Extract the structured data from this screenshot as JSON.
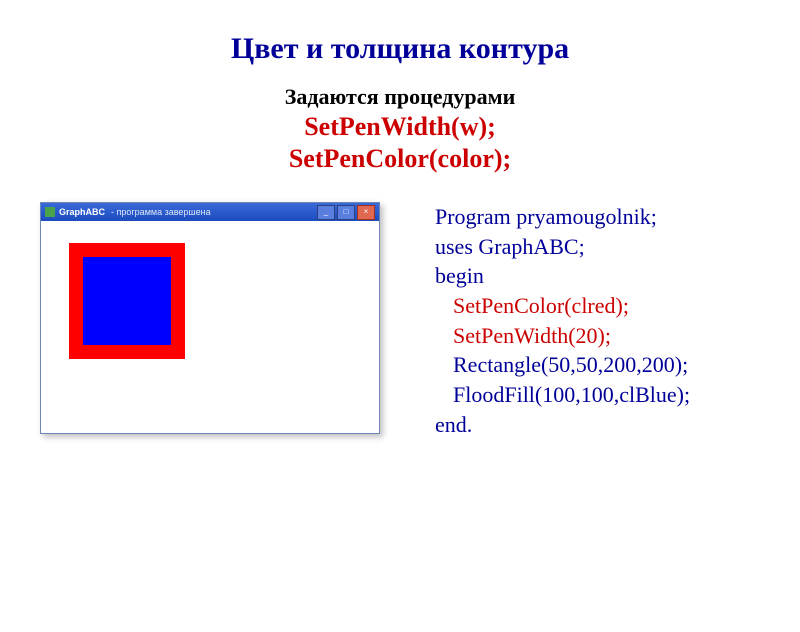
{
  "title": "Цвет и толщина контура",
  "subtitle_lead": "Задаются процедурами",
  "proc1": "SetPenWidth(w);",
  "proc2": "SetPenColor(color);",
  "window": {
    "icon_name": "app-icon",
    "title": "GraphABC",
    "subtitle": "- программа завершена",
    "btn_min": "_",
    "btn_max": "□",
    "btn_close": "×"
  },
  "code": {
    "l1": "Program pryamougolnik;",
    "l2": "uses GraphABC;",
    "l3": "begin",
    "l4": "SetPenColor(clred);",
    "l5": "SetPenWidth(20);",
    "l6": "Rectangle(50,50,200,200);",
    "l7": "FloodFill(100,100,clBlue);",
    "l8": "end."
  }
}
